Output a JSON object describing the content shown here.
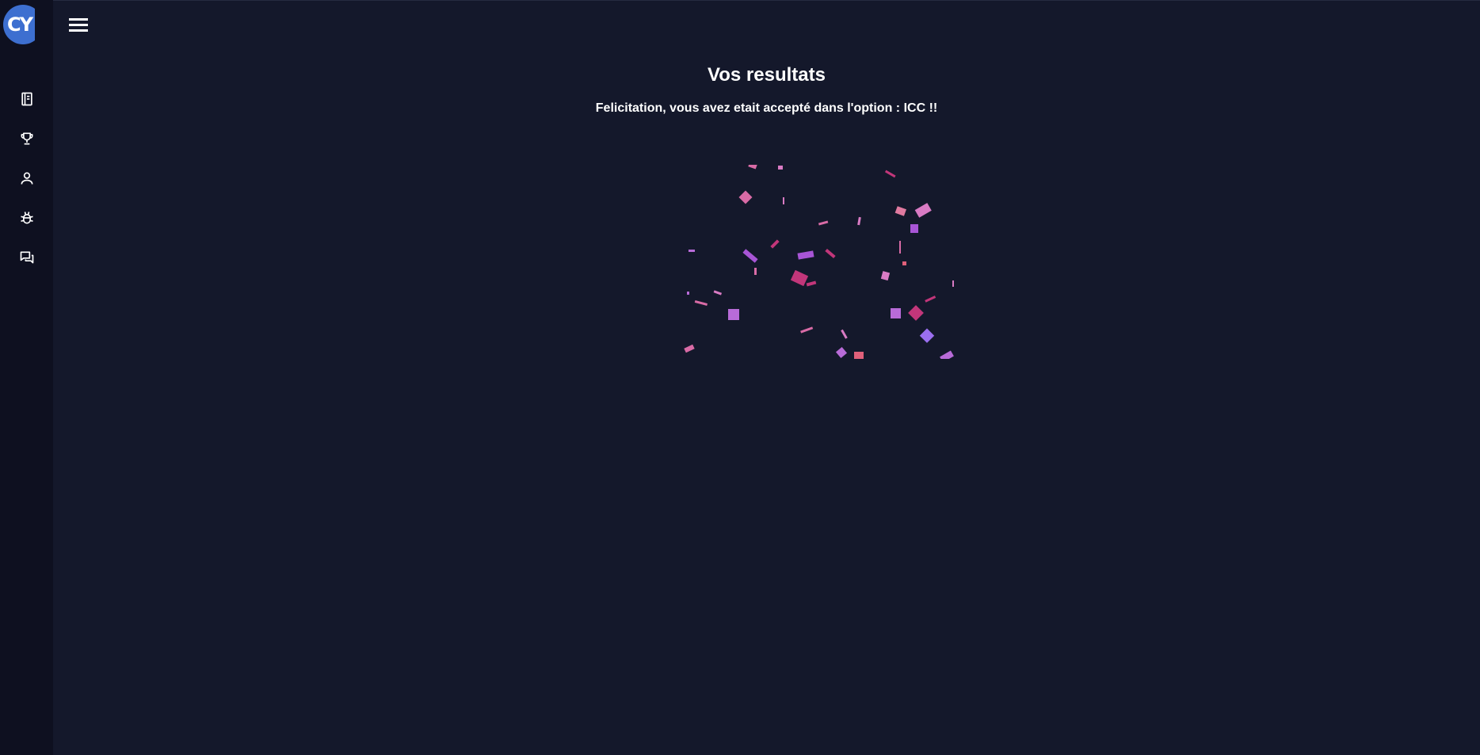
{
  "app": {
    "logo_text": "CY",
    "brand_color": "#3d6fd0"
  },
  "sidebar": {
    "items": [
      {
        "icon": "book-icon",
        "label": "Courses"
      },
      {
        "icon": "trophy-icon",
        "label": "Results"
      },
      {
        "icon": "user-icon",
        "label": "Profile"
      },
      {
        "icon": "bug-icon",
        "label": "Report bug"
      },
      {
        "icon": "chat-icon",
        "label": "Messages"
      }
    ]
  },
  "topbar": {
    "menu_icon": "hamburger-menu-icon"
  },
  "main": {
    "title": "Vos resultats",
    "message": "Felicitation, vous avez etait accepté dans l'option : ICC !!"
  },
  "confetti": {
    "colors": [
      "#d96ba6",
      "#a855d6",
      "#c2367a",
      "#e0607a",
      "#b86bd8",
      "#9b6ff0"
    ]
  },
  "theme": {
    "background": "#14182b",
    "sidebar": "#0e1020",
    "text": "#ffffff"
  }
}
